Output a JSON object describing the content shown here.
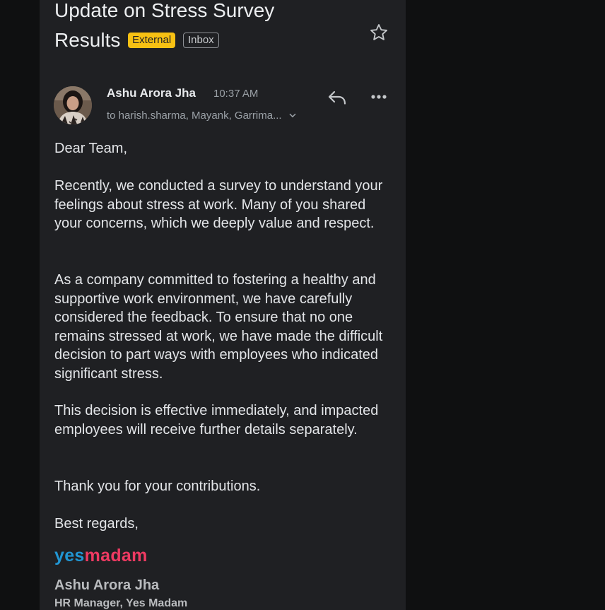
{
  "email": {
    "subject_line1": "Update on Stress Survey",
    "subject_line2": "Results",
    "labels": {
      "external": "External",
      "inbox": "Inbox"
    },
    "sender": {
      "name": "Ashu Arora Jha",
      "time": "10:37 AM",
      "recipients": "to harish.sharma, Mayank, Garrima..."
    },
    "body": {
      "greeting": "Dear Team,",
      "paragraph1": "Recently, we conducted a survey to understand your feelings about stress at work. Many of you shared your concerns, which we deeply value and respect.",
      "paragraph2": "As a company committed to fostering a healthy and supportive work environment, we have carefully considered the feedback. To ensure that no one remains stressed at work, we have made the difficult decision to part ways with employees who indicated significant stress.",
      "paragraph3": "This decision is effective immediately, and impacted employees will receive further details separately.",
      "thanks": "Thank you for your contributions.",
      "closing": "Best regards,"
    },
    "signature": {
      "logo_part1": "yes",
      "logo_part2": "madam",
      "name": "Ashu Arora Jha",
      "title": "HR Manager, Yes Madam"
    }
  },
  "icons": {
    "star": "star-icon",
    "reply": "reply-icon",
    "more": "more-icon",
    "chevron": "chevron-down-icon",
    "avatar": "avatar"
  },
  "colors": {
    "background": "#111213",
    "panel": "#1f2023",
    "external_badge": "#f7c113",
    "logo_blue": "#2196d3",
    "logo_pink": "#ef3a62"
  }
}
